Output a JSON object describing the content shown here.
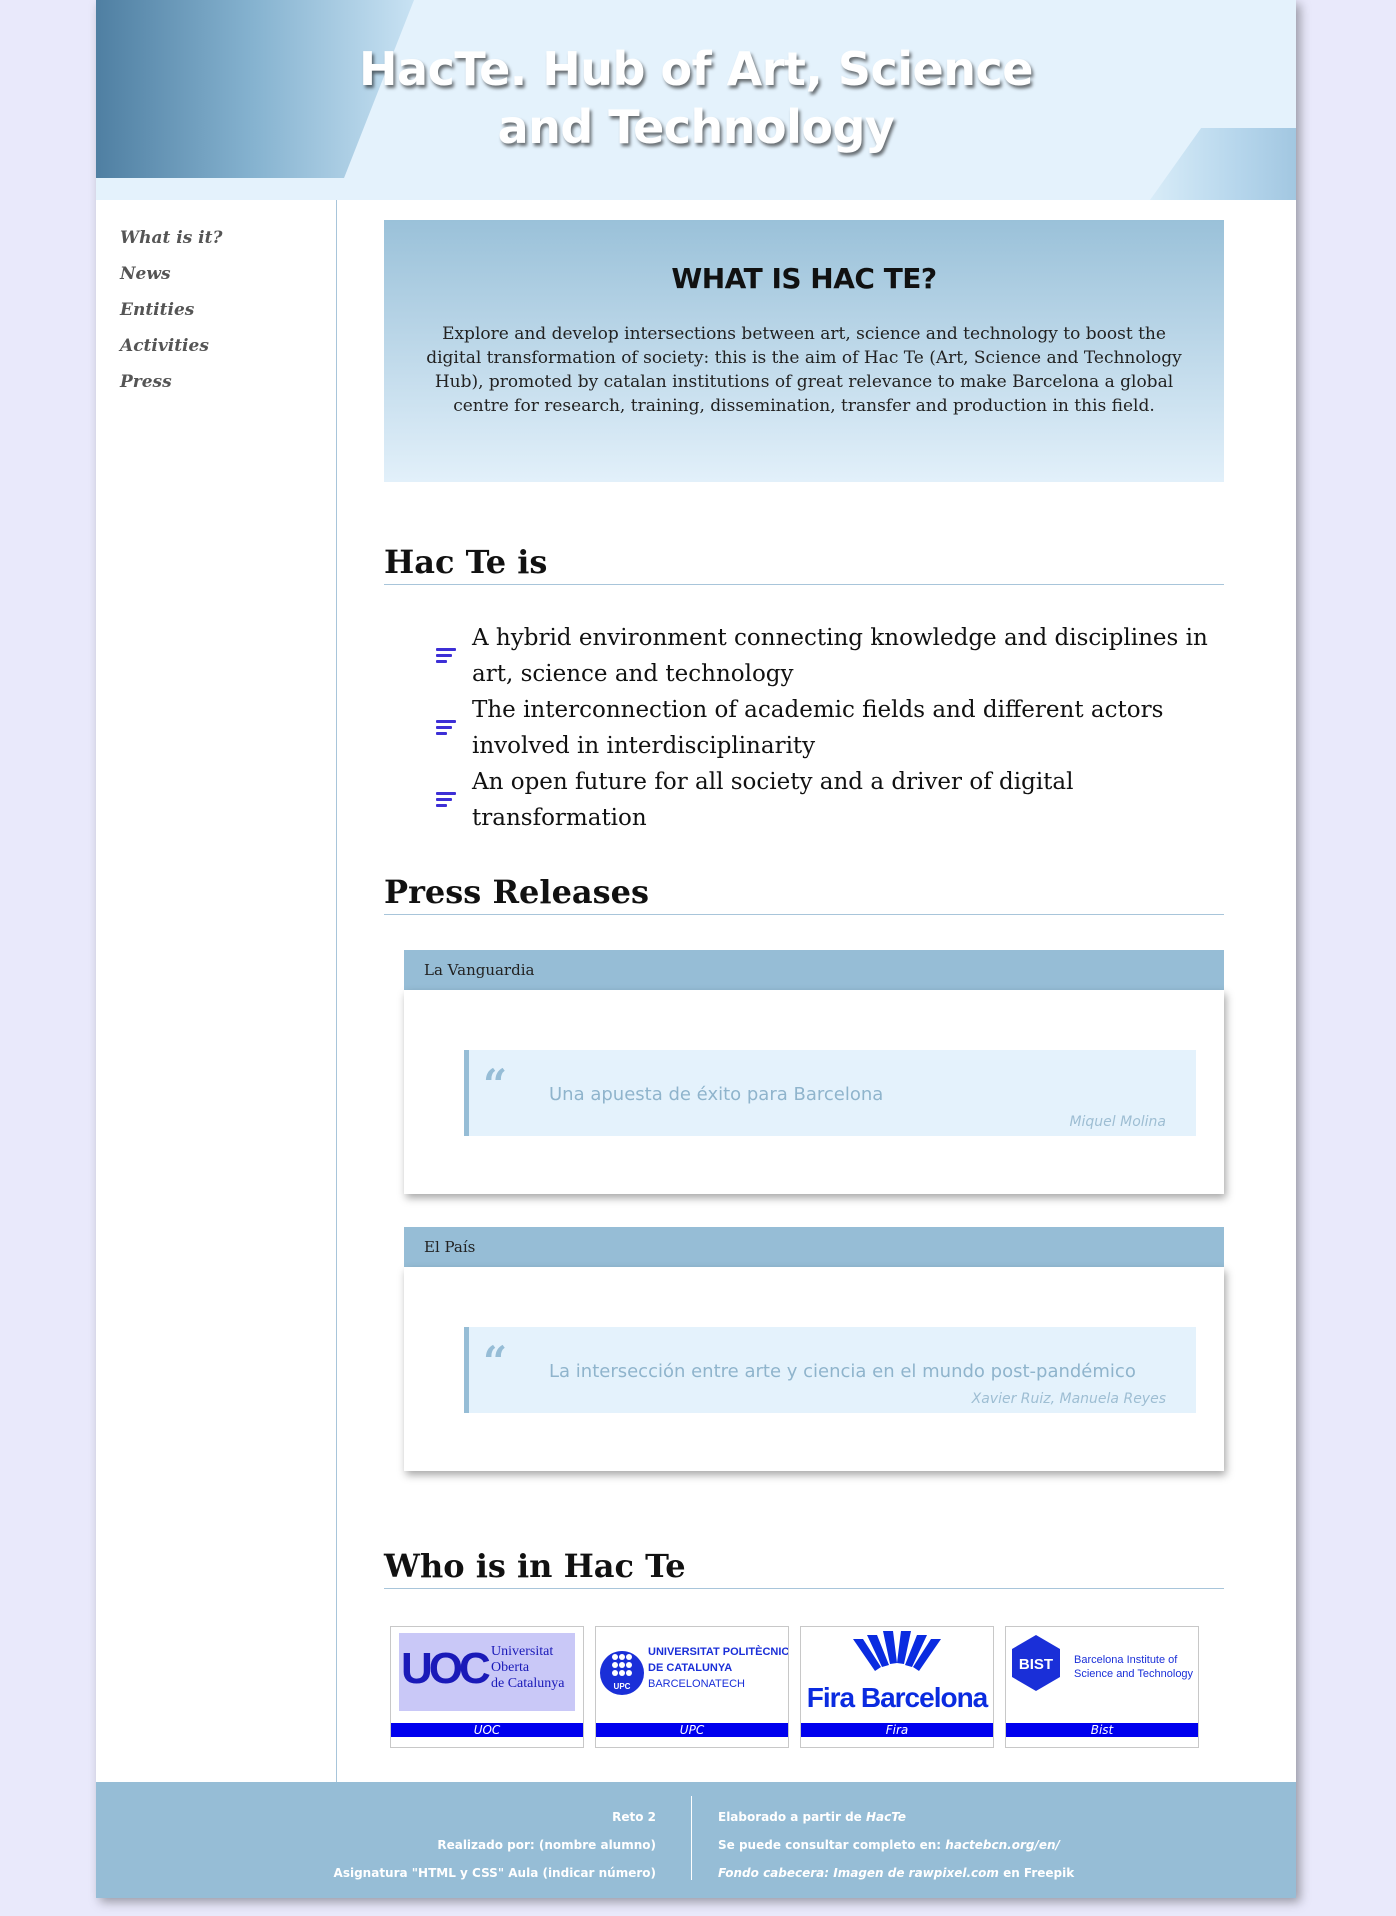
{
  "header": {
    "title": "HacTe. Hub of Art, Science and Technology"
  },
  "sidebar": {
    "items": [
      {
        "label": "What is it?"
      },
      {
        "label": "News"
      },
      {
        "label": "Entities"
      },
      {
        "label": "Activities"
      },
      {
        "label": "Press"
      }
    ]
  },
  "hero": {
    "title": "WHAT IS HAC TE?",
    "text": "Explore and develop intersections between art, science and technology to boost the digital transformation of society: this is the aim of Hac Te (Art, Science and Technology Hub), promoted by catalan institutions of great relevance to make Barcelona a global centre for research, training, dissemination, transfer and production in this field."
  },
  "about": {
    "title": "Hac Te is",
    "items": [
      "A hybrid environment connecting knowledge and disciplines in art, science and technology",
      "The interconnection of academic fields and different actors involved in interdisciplinarity",
      "An open future for all society and a driver of digital transformation"
    ]
  },
  "press": {
    "title": "Press Releases",
    "items": [
      {
        "source": "La Vanguardia",
        "quote": "Una apuesta de éxito para Barcelona",
        "author": "Miquel Molina"
      },
      {
        "source": "El País",
        "quote": "La intersección entre arte y ciencia en el mundo post-pandémico",
        "author": "Xavier Ruiz, Manuela Reyes"
      }
    ]
  },
  "members": {
    "title": "Who is in Hac Te",
    "logos": [
      {
        "caption": "UOC",
        "text_lines": [
          "Universitat",
          "Oberta",
          "de Catalunya"
        ],
        "mark": "UOC"
      },
      {
        "caption": "UPC",
        "text_lines": [
          "UNIVERSITAT POLITÈCNICA",
          "DE CATALUNYA",
          "BARCELONATECH"
        ],
        "mark": "UPC"
      },
      {
        "caption": "Fira",
        "text_lines": [
          "Fira Barcelona"
        ]
      },
      {
        "caption": "Bist",
        "text_lines": [
          "Barcelona Institute of",
          "Science and Technology"
        ],
        "mark": "BIST"
      }
    ]
  },
  "footer": {
    "left": [
      "Reto 2",
      "Realizado por: (nombre alumno)",
      "Asignatura \"HTML y CSS\" Aula (indicar número)"
    ],
    "right_1_prefix": "Elaborado a partir de ",
    "right_1_em": "HacTe",
    "right_2_prefix": "Se puede consultar completo en: ",
    "right_2_em": "hactebcn.org/en/",
    "right_3_em": "Fondo cabecera: Imagen de rawpixel.com",
    "right_3_suffix": " en Freepik"
  },
  "colors": {
    "accent": "#96bdd6",
    "header_bg": "#e4f2fc",
    "list_icon": "#3d2fd6",
    "logo_caption": "#0000ee"
  }
}
